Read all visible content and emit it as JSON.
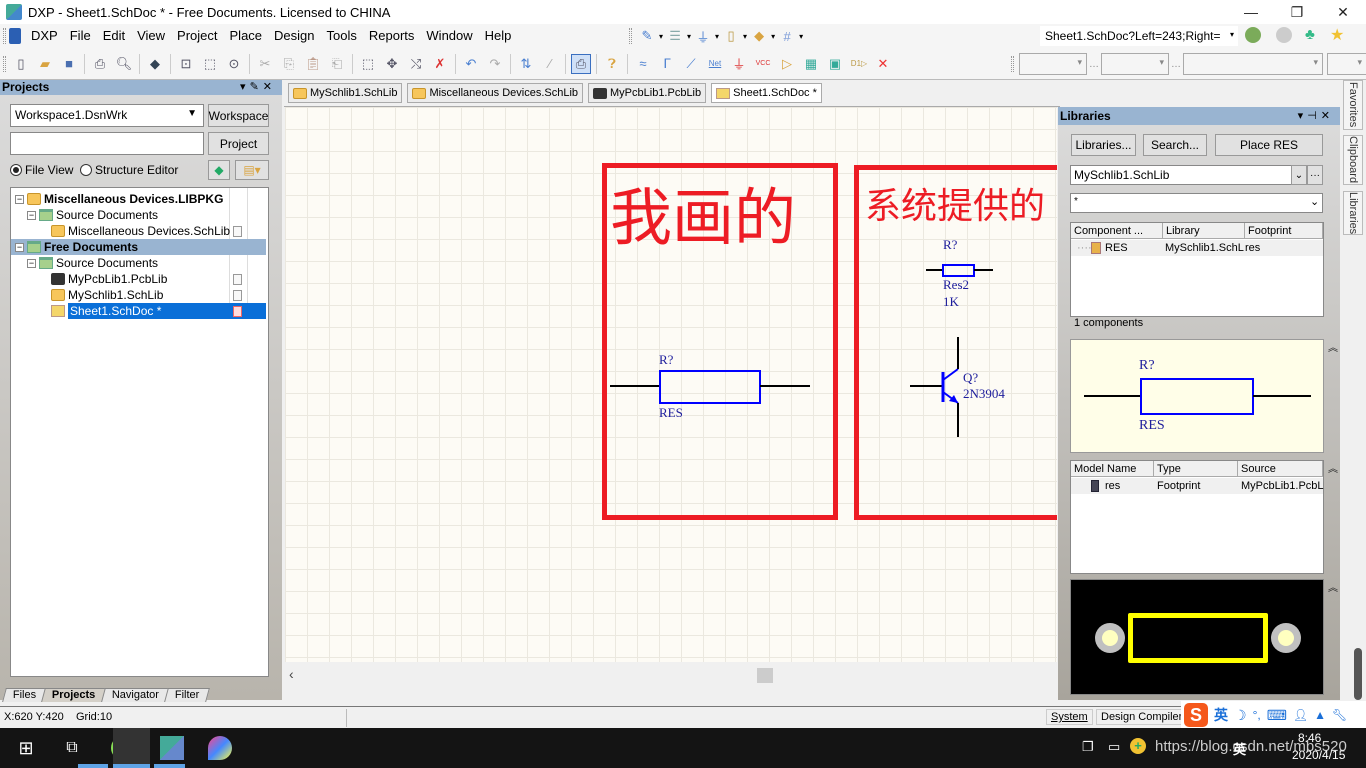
{
  "window": {
    "title": "DXP - Sheet1.SchDoc * - Free Documents. Licensed to CHINA",
    "controls": {
      "minimize": "—",
      "maximize": "❐",
      "close": "✕"
    }
  },
  "menu": {
    "items": [
      "DXP",
      "File",
      "Edit",
      "View",
      "Project",
      "Place",
      "Design",
      "Tools",
      "Reports",
      "Window",
      "Help"
    ],
    "nav_location": "Sheet1.SchDoc?Left=243;Right="
  },
  "toolbar": {
    "icons": [
      "new-doc-icon",
      "open-icon",
      "save-icon",
      "print-icon",
      "print-preview-icon",
      "component-icon",
      "zoom-fit-icon",
      "zoom-area-icon",
      "zoom-selected-icon",
      "cut-icon",
      "copy-icon",
      "paste-icon",
      "rubber-stamp-icon",
      "select-area-icon",
      "move-icon",
      "deselect-icon",
      "clear-filter-icon",
      "undo-icon",
      "redo-icon",
      "hierarchy-icon",
      "cross-probe-icon",
      "browse-library-icon",
      "help-icon",
      "wire-icon",
      "bus-icon",
      "bus-entry-icon",
      "net-label-icon",
      "gnd-icon",
      "vcc-icon",
      "part-icon",
      "sheet-symbol-icon",
      "sheet-entry-icon",
      "port-icon",
      "no-erc-icon"
    ]
  },
  "projects_panel": {
    "title": "Projects",
    "workspace_value": "Workspace1.DsnWrk",
    "workspace_button": "Workspace",
    "project_value": "",
    "project_button": "Project",
    "view_options": [
      {
        "label": "File View",
        "selected": true
      },
      {
        "label": "Structure Editor",
        "selected": false
      }
    ],
    "tree": [
      {
        "label": "Miscellaneous Devices.LIBPKG",
        "level": 0,
        "bold": true,
        "icon": "libpkg-icon"
      },
      {
        "label": "Source Documents",
        "level": 1,
        "icon": "folder-icon"
      },
      {
        "label": "Miscellaneous Devices.SchLib",
        "level": 2,
        "icon": "schlib-icon"
      },
      {
        "label": "Free Documents",
        "level": 0,
        "bold": true,
        "icon": "folder-icon",
        "highlight": true
      },
      {
        "label": "Source Documents",
        "level": 1,
        "icon": "folder-icon"
      },
      {
        "label": "MyPcbLib1.PcbLib",
        "level": 2,
        "icon": "pcblib-icon"
      },
      {
        "label": "MySchlib1.SchLib",
        "level": 2,
        "icon": "schlib-icon"
      },
      {
        "label": "Sheet1.SchDoc *",
        "level": 2,
        "icon": "schdoc-icon",
        "selected": true
      }
    ],
    "bottom_tabs": [
      "Files",
      "Projects",
      "Navigator",
      "Filter"
    ],
    "active_bottom_tab": "Projects"
  },
  "doc_tabs": [
    {
      "label": "MySchlib1.SchLib",
      "icon": "schlib-icon"
    },
    {
      "label": "Miscellaneous Devices.SchLib",
      "icon": "schlib-icon"
    },
    {
      "label": "MyPcbLib1.PcbLib",
      "icon": "pcblib-icon"
    },
    {
      "label": "Sheet1.SchDoc *",
      "icon": "schdoc-icon",
      "active": true
    }
  ],
  "canvas": {
    "left_box_label": "我画的",
    "right_box_label": "系统提供的",
    "my_resistor": {
      "designator": "R?",
      "comment": "RES"
    },
    "sys_resistor": {
      "designator": "R?",
      "comment": "Res2",
      "value": "1K"
    },
    "sys_transistor": {
      "designator": "Q?",
      "comment": "2N3904"
    },
    "annotation_color": "#ed1c24",
    "symbol_color": "#0000ff"
  },
  "libraries_panel": {
    "title": "Libraries",
    "buttons": [
      "Libraries...",
      "Search...",
      "Place RES"
    ],
    "library_value": "MySchlib1.SchLib",
    "filter_value": "*",
    "component_columns": [
      "Component ...",
      "Library",
      "Footprint"
    ],
    "components": [
      {
        "name": "RES",
        "library": "MySchlib1.SchL",
        "footprint": "res"
      }
    ],
    "count_text": "1 components",
    "preview": {
      "designator": "R?",
      "comment": "RES"
    },
    "model_columns": [
      "Model Name",
      "Type",
      "Source"
    ],
    "models": [
      {
        "name": "res",
        "type": "Footprint",
        "source": "MyPcbLib1.PcbL"
      }
    ]
  },
  "side_tabs": [
    "Favorites",
    "Clipboard",
    "Libraries"
  ],
  "status": {
    "coords": "X:620 Y:420",
    "grid": "Grid:10",
    "panels": [
      "System",
      "Design Compiler"
    ]
  },
  "ime_bar": [
    "S",
    "英",
    "☽",
    "°,",
    "⌨",
    "👤",
    "👕",
    "🔧"
  ],
  "taskbar": {
    "time": "8:46",
    "date": "2020/4/15",
    "watermark": "https://blog.csdn.net/mbs520",
    "ime": "英"
  }
}
